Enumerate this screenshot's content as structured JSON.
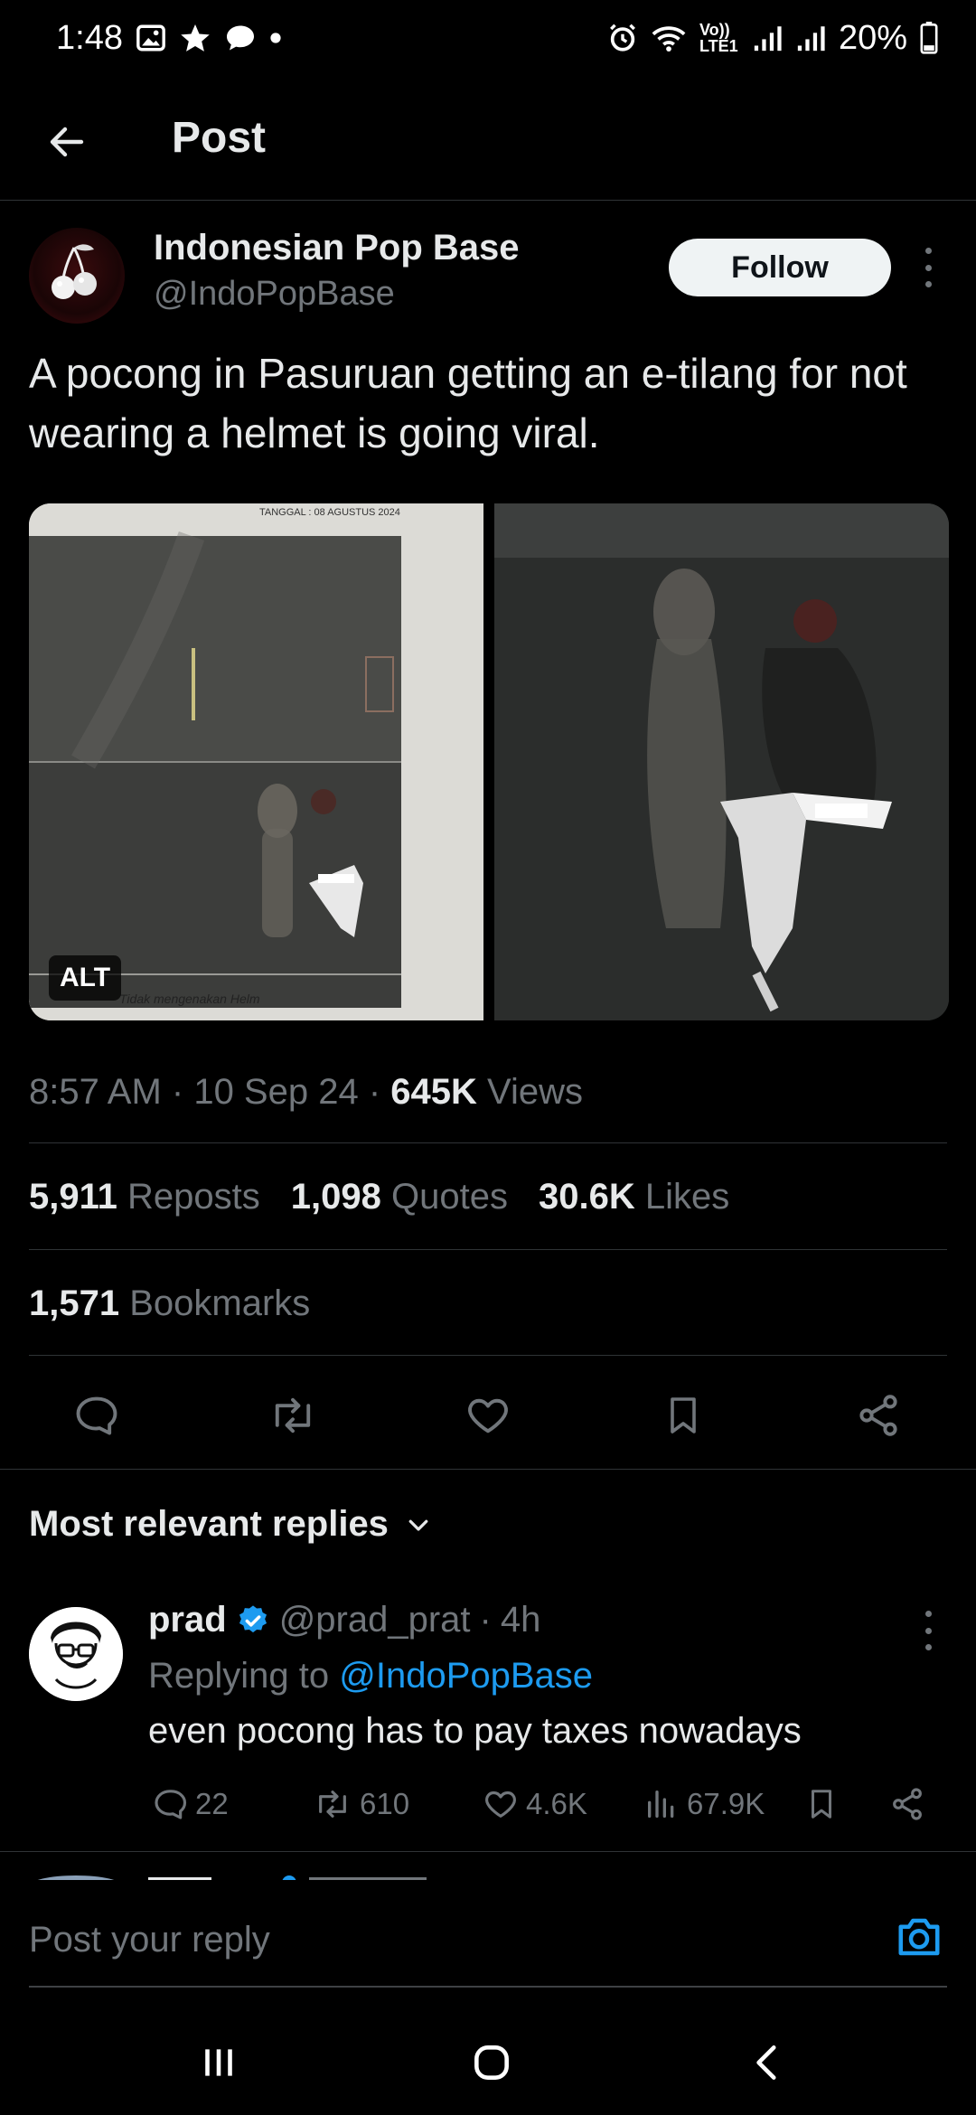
{
  "status_bar": {
    "time": "1:48",
    "battery": "20%",
    "network_label": "Vo)) LTE1"
  },
  "header": {
    "title": "Post"
  },
  "post": {
    "author_name": "Indonesian Pop Base",
    "author_handle": "@IndoPopBase",
    "follow_label": "Follow",
    "text": "A pocong in Pasuruan getting an e-tilang for not wearing a helmet is going viral.",
    "media": {
      "alt_label": "ALT",
      "left_doc_header": "TANGGAL : 08 AGUSTUS 2024",
      "left_doc_caption": "Tidak mengenakan Helm"
    },
    "time": "8:57 AM",
    "date": "10 Sep 24",
    "views_count": "645K",
    "views_label": "Views",
    "stats": {
      "reposts_count": "5,911",
      "reposts_label": "Reposts",
      "quotes_count": "1,098",
      "quotes_label": "Quotes",
      "likes_count": "30.6K",
      "likes_label": "Likes",
      "bookmarks_count": "1,571",
      "bookmarks_label": "Bookmarks"
    }
  },
  "replies_section": {
    "title": "Most relevant replies"
  },
  "reply": {
    "name": "prad",
    "handle": "@prad_prat",
    "time": "4h",
    "replying_prefix": "Replying to",
    "replying_to": "@IndoPopBase",
    "text": "even pocong has to pay taxes nowadays",
    "replies_count": "22",
    "reposts_count": "610",
    "likes_count": "4.6K",
    "views_count": "67.9K"
  },
  "composer": {
    "placeholder": "Post your reply"
  },
  "colors": {
    "background": "#000000",
    "text_primary": "#e7e9ea",
    "text_secondary": "#71767b",
    "accent": "#1d9bf0",
    "divider": "#2f3336"
  }
}
